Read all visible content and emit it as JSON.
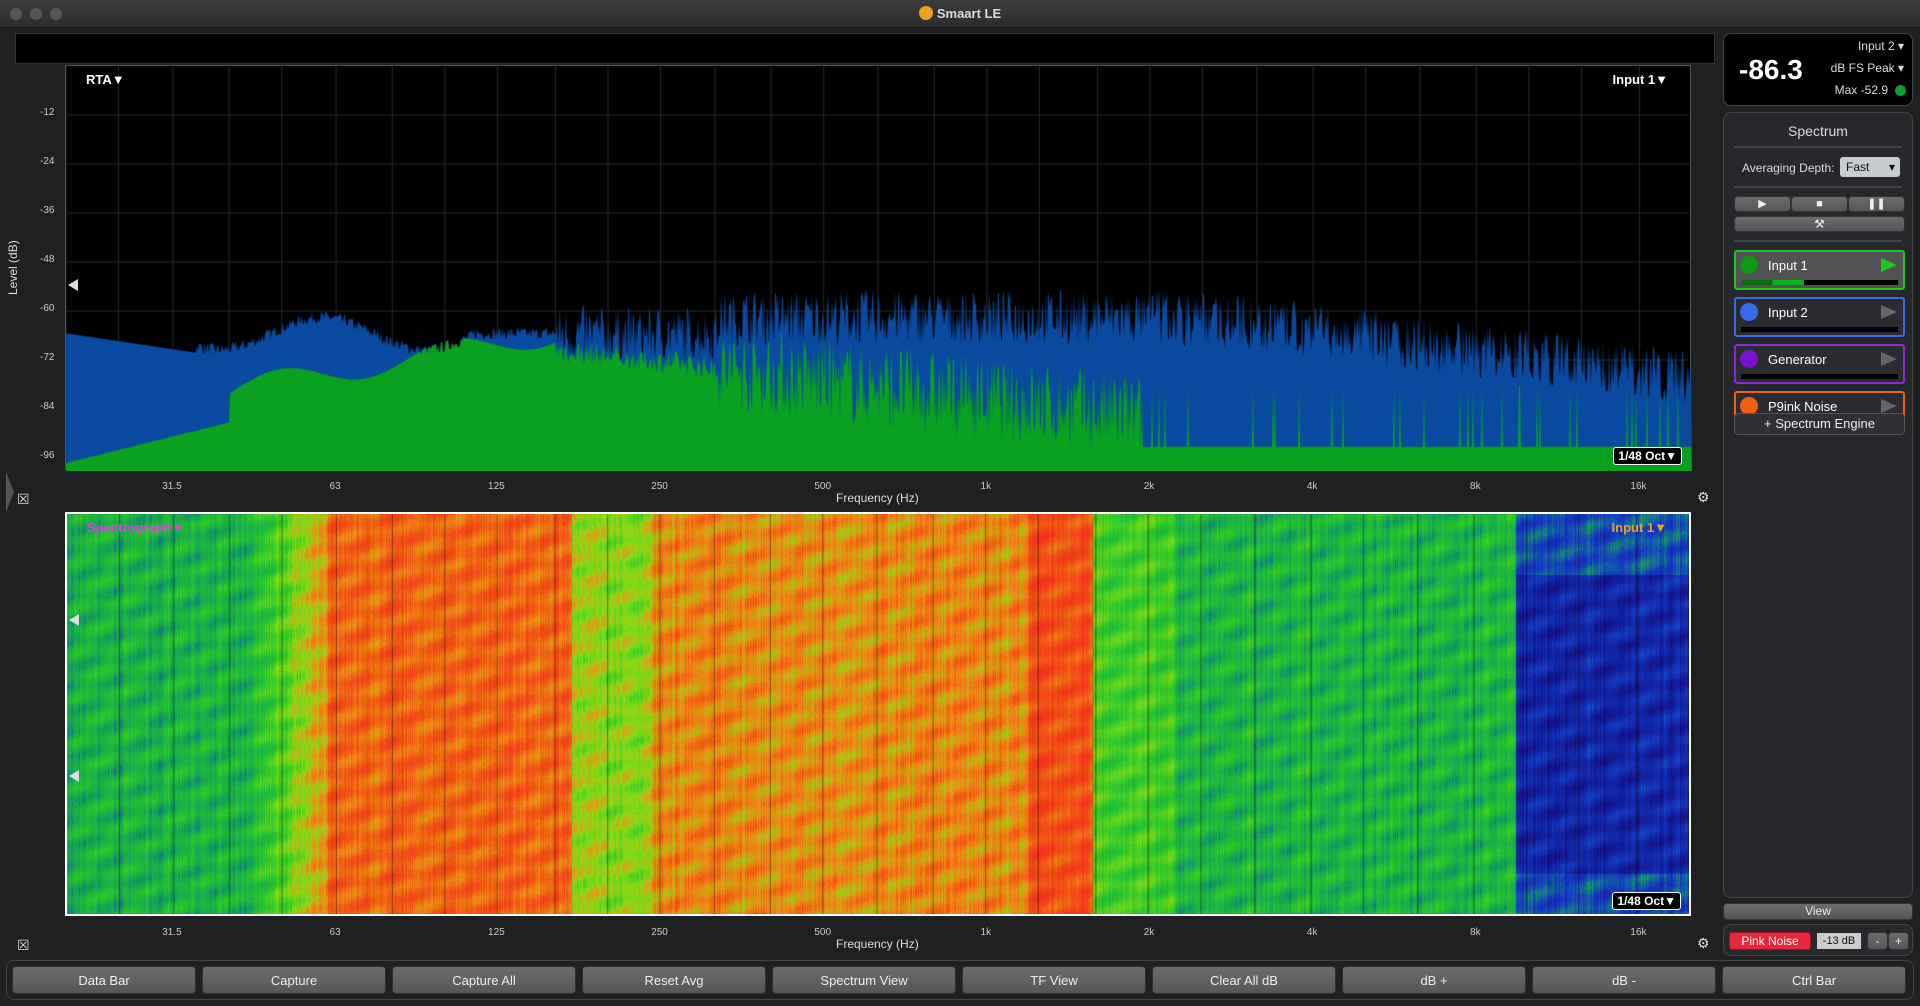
{
  "window": {
    "title": "Smaart LE"
  },
  "rta": {
    "mode_label": "RTA▼",
    "input_label": "Input 1▼",
    "resolution": "1/48 Oct▼",
    "y_axis_label": "Level (dB)",
    "y_ticks": [
      "-12",
      "-24",
      "-36",
      "-48",
      "-60",
      "-72",
      "-84",
      "-96"
    ],
    "x_axis_label": "Frequency (Hz)",
    "x_ticks": [
      "31.5",
      "63",
      "125",
      "250",
      "500",
      "1k",
      "2k",
      "4k",
      "8k",
      "16k"
    ],
    "x_range_hz": [
      20,
      20000
    ],
    "y_range_db": [
      -100,
      0
    ],
    "series_colors": {
      "input2": "#0a4aa0",
      "input1": "#0aa020"
    }
  },
  "spectrograph": {
    "mode_label": "Spectrograph▼",
    "input_label": "Input 1▼",
    "resolution": "1/48 Oct▼",
    "x_axis_label": "Frequency (Hz)",
    "x_ticks": [
      "31.5",
      "63",
      "125",
      "250",
      "500",
      "1k",
      "2k",
      "4k",
      "8k",
      "16k"
    ]
  },
  "meter": {
    "value": "-86.3",
    "source": "Input 2",
    "unit": "dB FS Peak",
    "max": "Max -52.9",
    "status_color": "#0aa030"
  },
  "spectrum_panel": {
    "title": "Spectrum",
    "averaging_label": "Averaging Depth:",
    "averaging_value": "Fast",
    "engines": [
      {
        "name": "Input 1",
        "color": "#0a9a14",
        "border": "#1ec81e",
        "active": true,
        "level": 0.4
      },
      {
        "name": "Input 2",
        "color": "#3a6ae8",
        "border": "#3a6ae8",
        "active": false,
        "level": 0
      },
      {
        "name": "Generator",
        "color": "#7a10d0",
        "border": "#8a2ad0",
        "active": false,
        "level": 0
      },
      {
        "name": "P9ink Noise",
        "color": "#f06010",
        "border": "#f06010",
        "active": false,
        "level": 0
      }
    ],
    "add_engine": "+ Spectrum Engine"
  },
  "view_label": "View",
  "generator": {
    "label": "Pink Noise",
    "level": "-13 dB",
    "minus": "-",
    "plus": "+"
  },
  "bottom_buttons": [
    "Data Bar",
    "Capture",
    "Capture All",
    "Reset Avg",
    "Spectrum View",
    "TF View",
    "Clear All dB",
    "dB +",
    "dB -",
    "Ctrl Bar"
  ]
}
